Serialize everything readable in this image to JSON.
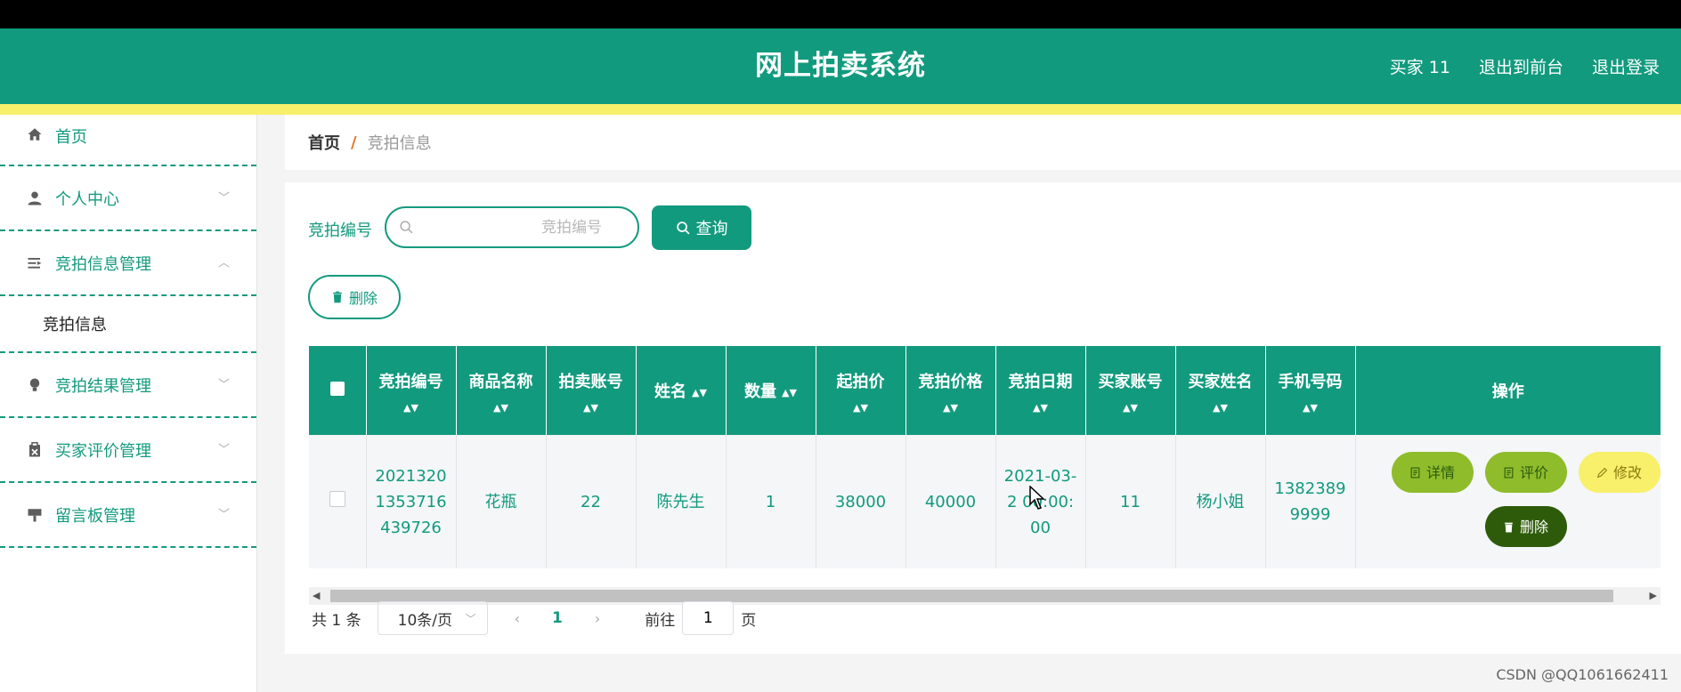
{
  "header": {
    "title": "网上拍卖系统",
    "user": "买家 11",
    "front_link": "退出到前台",
    "logout": "退出登录"
  },
  "sidebar": {
    "items": [
      {
        "label": "首页",
        "icon": "home-icon"
      },
      {
        "label": "个人中心",
        "icon": "user-icon"
      },
      {
        "label": "竞拍信息管理",
        "icon": "list-icon",
        "expanded": true,
        "children": [
          "竞拍信息"
        ]
      },
      {
        "label": "竞拍结果管理",
        "icon": "bulb-icon"
      },
      {
        "label": "买家评价管理",
        "icon": "clipboard-icon"
      },
      {
        "label": "留言板管理",
        "icon": "board-icon"
      }
    ]
  },
  "breadcrumb": {
    "home": "首页",
    "separator": "/",
    "current": "竞拍信息"
  },
  "search": {
    "label": "竞拍编号",
    "placeholder": "竞拍编号",
    "value": "",
    "button": "查询"
  },
  "toolbar": {
    "delete_label": "删除"
  },
  "table": {
    "columns": [
      "竞拍编号",
      "商品名称",
      "拍卖账号",
      "姓名",
      "数量",
      "起拍价",
      "竞拍价格",
      "竞拍日期",
      "买家账号",
      "买家姓名",
      "手机号码",
      "操作"
    ],
    "rows": [
      {
        "bid_no": "20213201353716439726",
        "product": "花瓶",
        "seller_account": "22",
        "name": "陈先生",
        "quantity": "1",
        "start_price": "38000",
        "bid_price": "40000",
        "bid_date": "2021-03-2 00:00:00",
        "buyer_account": "11",
        "buyer_name": "杨小姐",
        "phone": "13823899999",
        "actions": {
          "detail": "详情",
          "review": "评价",
          "edit": "修改",
          "delete": "删除"
        }
      }
    ]
  },
  "pagination": {
    "total": "共 1 条",
    "page_size": "10条/页",
    "current": "1",
    "goto_prefix": "前往",
    "goto_value": "1",
    "goto_suffix": "页"
  },
  "watermark": "CSDN @QQ1061662411",
  "colors": {
    "primary": "#129a7e",
    "accent_yellow": "#f8ef6b",
    "op_green": "#8fbc2b",
    "op_dark": "#2e5b0a"
  }
}
